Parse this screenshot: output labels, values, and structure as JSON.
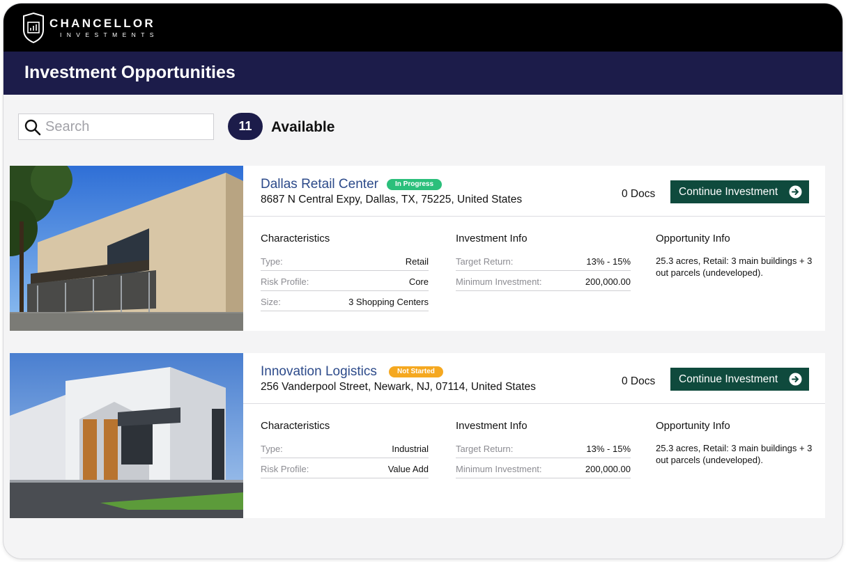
{
  "brand": {
    "name": "CHANCELLOR",
    "subtitle": "INVESTMENTS"
  },
  "header": {
    "title": "Investment Opportunities"
  },
  "search": {
    "placeholder": "Search",
    "value": ""
  },
  "summary": {
    "count": "11",
    "label": "Available"
  },
  "colors": {
    "topbar": "#000000",
    "titlebar": "#1c1c4a",
    "button": "#0f4a3d",
    "in_progress": "#2bbf7b",
    "not_started": "#f5a820",
    "link": "#2c4a8a"
  },
  "opportunities": [
    {
      "name": "Dallas Retail Center",
      "status": "In Progress",
      "status_color": "#2bbf7b",
      "address": "8687 N Central Expy, Dallas, TX, 75225, United States",
      "docs": "0 Docs",
      "action": "Continue Investment",
      "characteristics_title": "Characteristics",
      "characteristics": [
        {
          "label": "Type:",
          "value": "Retail"
        },
        {
          "label": "Risk Profile:",
          "value": "Core"
        },
        {
          "label": "Size:",
          "value": "3 Shopping Centers"
        }
      ],
      "investment_title": "Investment Info",
      "investment": [
        {
          "label": "Target Return:",
          "value": "13% - 15%"
        },
        {
          "label": "Minimum Investment:",
          "value": "200,000.00"
        }
      ],
      "opportunity_title": "Opportunity Info",
      "opportunity_text": "25.3 acres, Retail: 3 main buildings + 3 out parcels (undeveloped)."
    },
    {
      "name": "Innovation Logistics",
      "status": "Not Started",
      "status_color": "#f5a820",
      "address": "256 Vanderpool Street, Newark, NJ, 07114, United States",
      "docs": "0 Docs",
      "action": "Continue Investment",
      "characteristics_title": "Characteristics",
      "characteristics": [
        {
          "label": "Type:",
          "value": "Industrial"
        },
        {
          "label": "Risk Profile:",
          "value": "Value Add"
        }
      ],
      "investment_title": "Investment Info",
      "investment": [
        {
          "label": "Target Return:",
          "value": "13% - 15%"
        },
        {
          "label": "Minimum Investment:",
          "value": "200,000.00"
        }
      ],
      "opportunity_title": "Opportunity Info",
      "opportunity_text": "25.3 acres, Retail: 3 main buildings + 3 out parcels (undeveloped)."
    }
  ]
}
